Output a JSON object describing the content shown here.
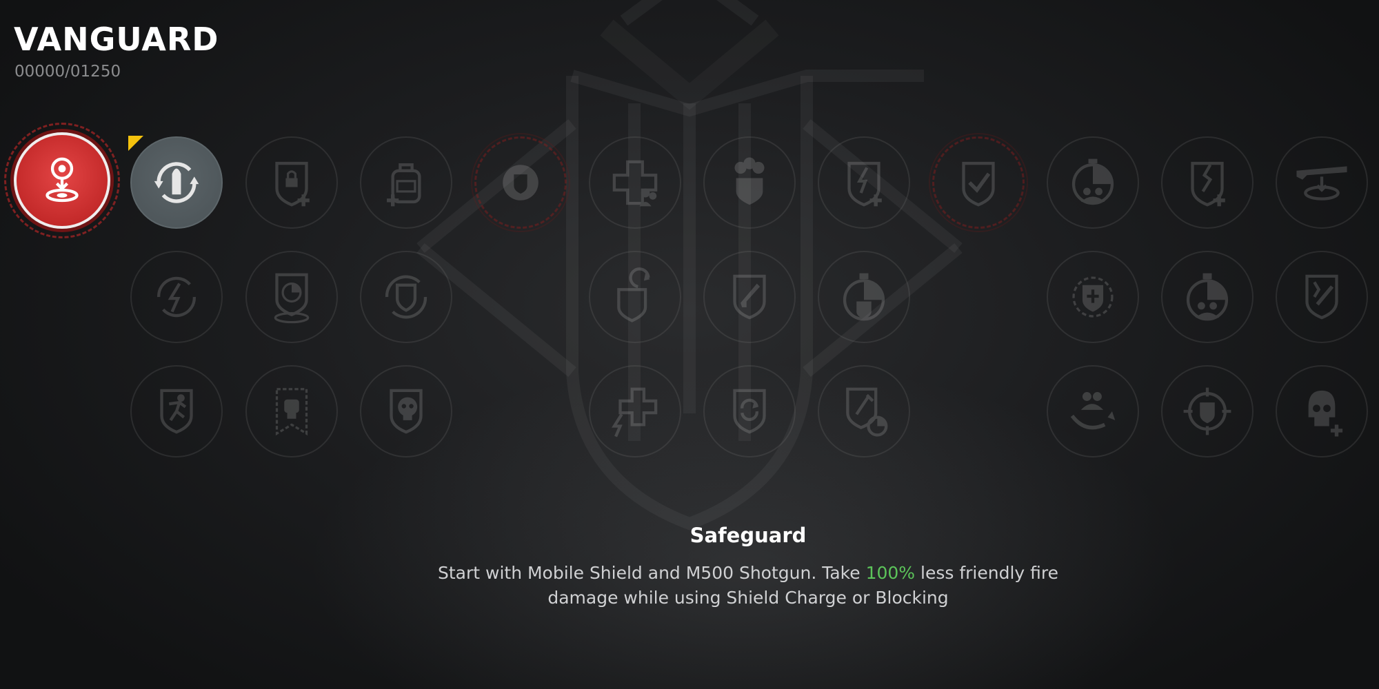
{
  "header": {
    "class_name": "VANGUARD",
    "xp_progress": "00000/01250"
  },
  "colors": {
    "active_red": "#c42a2a",
    "owned_grey": "#4a5256",
    "new_flag": "#f4c20d",
    "highlight_green": "#5cc45a"
  },
  "skill_grid": {
    "rows": [
      {
        "nodes": [
          {
            "icon": "deploy-shield-icon",
            "state": "active"
          },
          {
            "icon": "ammo-cycle-icon",
            "state": "owned",
            "new": true
          },
          {
            "icon": "shield-lock-plus-icon",
            "state": "locked"
          },
          {
            "icon": "backpack-plus-icon",
            "state": "locked"
          },
          {
            "icon": "shield-class-icon",
            "state": "class-slot"
          },
          {
            "icon": "medkit-team-icon",
            "state": "locked"
          },
          {
            "icon": "skulls-shield-icon",
            "state": "locked"
          },
          {
            "icon": "shield-bolt-plus-icon",
            "state": "locked"
          },
          {
            "icon": "shield-check-icon",
            "state": "class-slot"
          },
          {
            "icon": "timer-team-icon",
            "state": "locked"
          },
          {
            "icon": "shield-crack-plus-icon",
            "state": "locked"
          },
          {
            "icon": "weapon-zone-icon",
            "state": "locked"
          }
        ]
      },
      {
        "nodes": [
          {
            "icon": "bolt-cycle-icon",
            "state": "locked"
          },
          {
            "icon": "shield-timer-icon",
            "state": "locked"
          },
          {
            "icon": "shield-cycle-icon",
            "state": "locked"
          },
          {
            "icon": "shield-regen-icon",
            "state": "locked"
          },
          {
            "icon": "shield-rifle-icon",
            "state": "locked"
          },
          {
            "icon": "grenade-shield-icon",
            "state": "locked"
          },
          {
            "icon": "shield-medic-icon",
            "state": "locked"
          },
          {
            "icon": "grenade-team-icon",
            "state": "locked"
          },
          {
            "icon": "shield-break-icon",
            "state": "locked"
          }
        ]
      },
      {
        "nodes": [
          {
            "icon": "shield-runner-icon",
            "state": "locked"
          },
          {
            "icon": "banner-fist-icon",
            "state": "locked"
          },
          {
            "icon": "shield-skull-icon",
            "state": "locked"
          },
          {
            "icon": "bolt-medkit-icon",
            "state": "locked"
          },
          {
            "icon": "shield-refresh-icon",
            "state": "locked"
          },
          {
            "icon": "shield-melee-timer-icon",
            "state": "locked"
          },
          {
            "icon": "team-hand-icon",
            "state": "locked"
          },
          {
            "icon": "target-shield-icon",
            "state": "locked"
          },
          {
            "icon": "skull-plus-icon",
            "state": "locked"
          }
        ]
      }
    ]
  },
  "description": {
    "title": "Safeguard",
    "text_before": "Start with Mobile Shield and M500 Shotgun. Take ",
    "highlight": "100%",
    "text_after": " less friendly fire damage while using Shield Charge or Blocking"
  }
}
